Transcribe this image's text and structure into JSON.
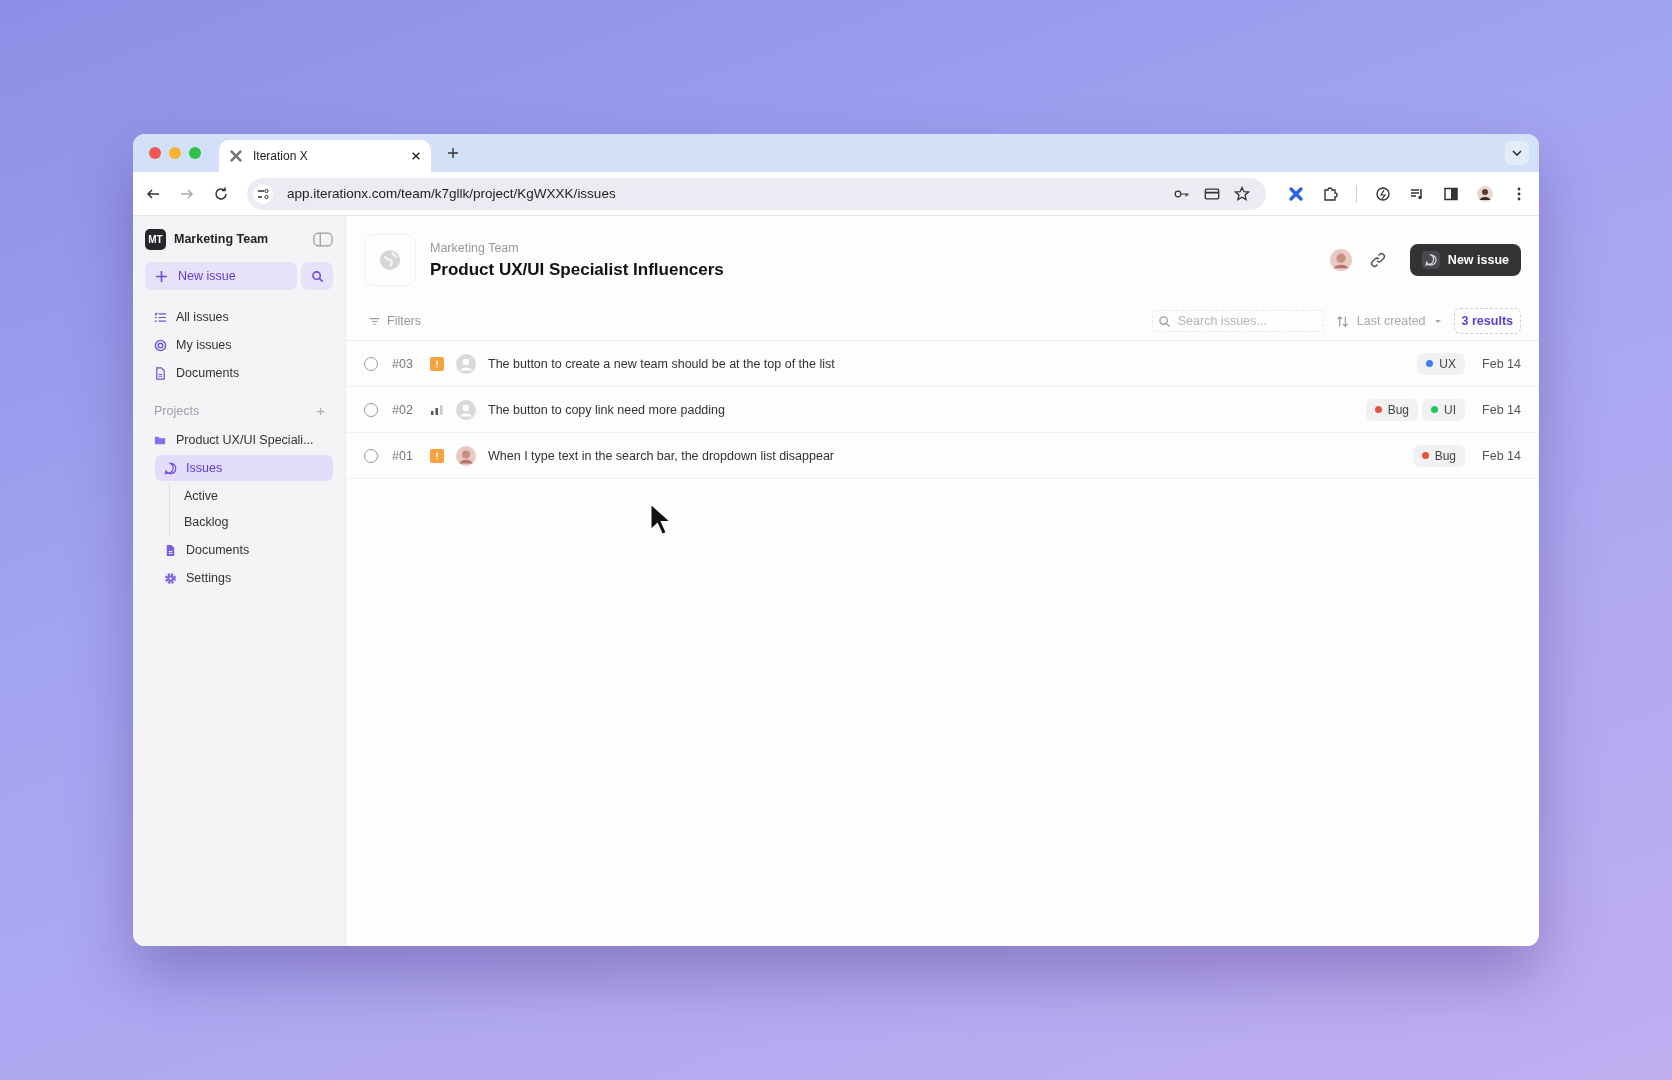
{
  "browser": {
    "tab_title": "Iteration X",
    "address": "app.iterationx.com/team/k7gllk/project/KgWXXK/issues"
  },
  "sidebar": {
    "team_badge": "MT",
    "team_name": "Marketing Team",
    "new_issue": "New issue",
    "nav": [
      {
        "label": "All issues",
        "kind": "list",
        "selected": false
      },
      {
        "label": "My issues",
        "kind": "target",
        "selected": false
      },
      {
        "label": "Documents",
        "kind": "doc",
        "selected": false
      }
    ],
    "projects_heading": "Projects",
    "add": "+",
    "project": {
      "name": "Product UX/UI Speciali...",
      "children": [
        {
          "label": "Issues",
          "kind": "issues",
          "selected": true,
          "children": [
            {
              "label": "Active",
              "selected": false
            },
            {
              "label": "Backlog",
              "selected": false
            }
          ]
        },
        {
          "label": "Documents",
          "kind": "doc",
          "selected": false
        },
        {
          "label": "Settings",
          "kind": "gear",
          "selected": false
        }
      ]
    }
  },
  "header": {
    "team": "Marketing Team",
    "title": "Product UX/UI Specialist Influencers",
    "new_issue": "New issue"
  },
  "toolbar": {
    "filters": "Filters",
    "search": {
      "placeholder": "Search issues..."
    },
    "sort": "Last created",
    "results": "3 results"
  },
  "issues": [
    {
      "id": "#03",
      "kind": "urgent",
      "assigned": false,
      "title": "The button to create a new team should be at the top of the list",
      "tags": [
        {
          "label": "UX",
          "color": "#3b82f6"
        }
      ],
      "date": "Feb 14",
      "done": false
    },
    {
      "id": "#02",
      "kind": "medium",
      "assigned": false,
      "title": "The button to copy link need more padding",
      "tags": [
        {
          "label": "Bug",
          "color": "#e5533d"
        },
        {
          "label": "UI",
          "color": "#22c55e"
        }
      ],
      "date": "Feb 14",
      "done": false
    },
    {
      "id": "#01",
      "kind": "urgent",
      "assigned": true,
      "title": "When I type text in the search bar, the dropdown list disappear",
      "tags": [
        {
          "label": "Bug",
          "color": "#e5533d"
        }
      ],
      "date": "Feb 14",
      "done": false
    }
  ]
}
